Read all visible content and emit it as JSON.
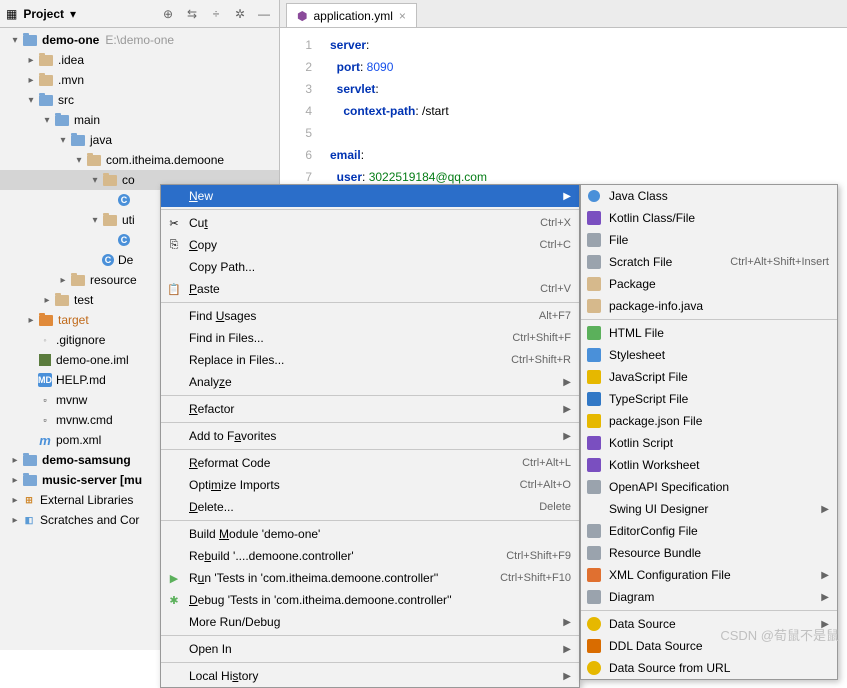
{
  "panel": {
    "title": "Project",
    "tools": [
      "target-icon",
      "arrow-down-icon",
      "divider-icon",
      "gear-icon",
      "collapse-icon"
    ]
  },
  "tree": [
    {
      "depth": 0,
      "arrow": "▾",
      "icon": "folder-blue",
      "label": "demo-one",
      "bold": true,
      "hint": "E:\\demo-one"
    },
    {
      "depth": 1,
      "arrow": "▸",
      "icon": "folder",
      "label": ".idea"
    },
    {
      "depth": 1,
      "arrow": "▸",
      "icon": "folder",
      "label": ".mvn"
    },
    {
      "depth": 1,
      "arrow": "▾",
      "icon": "folder-blue",
      "label": "src"
    },
    {
      "depth": 2,
      "arrow": "▾",
      "icon": "folder-blue",
      "label": "main"
    },
    {
      "depth": 3,
      "arrow": "▾",
      "icon": "folder-blue",
      "label": "java"
    },
    {
      "depth": 4,
      "arrow": "▾",
      "icon": "folder",
      "label": "com.itheima.demoone"
    },
    {
      "depth": 5,
      "arrow": "▾",
      "icon": "folder",
      "label": "co",
      "selected": true
    },
    {
      "depth": 6,
      "arrow": "",
      "icon": "class",
      "label": ""
    },
    {
      "depth": 5,
      "arrow": "▾",
      "icon": "folder",
      "label": "uti"
    },
    {
      "depth": 6,
      "arrow": "",
      "icon": "class",
      "label": ""
    },
    {
      "depth": 5,
      "arrow": "",
      "icon": "class",
      "label": "De"
    },
    {
      "depth": 3,
      "arrow": "▸",
      "icon": "folder",
      "label": "resource"
    },
    {
      "depth": 2,
      "arrow": "▸",
      "icon": "folder",
      "label": "test"
    },
    {
      "depth": 1,
      "arrow": "▸",
      "icon": "folder-orange",
      "label": "target",
      "orange": true
    },
    {
      "depth": 1,
      "arrow": "",
      "icon": "git",
      "label": ".gitignore"
    },
    {
      "depth": 1,
      "arrow": "",
      "icon": "iml",
      "label": "demo-one.iml"
    },
    {
      "depth": 1,
      "arrow": "",
      "icon": "md",
      "label": "HELP.md"
    },
    {
      "depth": 1,
      "arrow": "",
      "icon": "file",
      "label": "mvnw"
    },
    {
      "depth": 1,
      "arrow": "",
      "icon": "file",
      "label": "mvnw.cmd"
    },
    {
      "depth": 1,
      "arrow": "",
      "icon": "m",
      "label": "pom.xml"
    },
    {
      "depth": 0,
      "arrow": "▸",
      "icon": "folder-blue",
      "label": "demo-samsung",
      "bold": true
    },
    {
      "depth": 0,
      "arrow": "▸",
      "icon": "folder-blue",
      "label": "music-server [mu",
      "bold": true
    },
    {
      "depth": 0,
      "arrow": "▸",
      "icon": "libs",
      "label": "External Libraries"
    },
    {
      "depth": 0,
      "arrow": "▸",
      "icon": "scratch",
      "label": "Scratches and Cor"
    }
  ],
  "tab": {
    "label": "application.yml"
  },
  "code": {
    "lines": [
      {
        "n": 1,
        "tokens": [
          [
            "kw",
            "server"
          ],
          [
            "",
            ":"
          ]
        ]
      },
      {
        "n": 2,
        "tokens": [
          [
            "",
            "  "
          ],
          [
            "kw",
            "port"
          ],
          [
            "",
            ": "
          ],
          [
            "num",
            "8090"
          ]
        ]
      },
      {
        "n": 3,
        "tokens": [
          [
            "",
            "  "
          ],
          [
            "kw",
            "servlet"
          ],
          [
            "",
            ":"
          ]
        ]
      },
      {
        "n": 4,
        "tokens": [
          [
            "",
            "    "
          ],
          [
            "kw",
            "context-path"
          ],
          [
            "",
            ": /start"
          ]
        ]
      },
      {
        "n": 5,
        "tokens": []
      },
      {
        "n": 6,
        "tokens": [
          [
            "kw",
            "email"
          ],
          [
            "",
            ":"
          ]
        ]
      },
      {
        "n": 7,
        "tokens": [
          [
            "",
            "  "
          ],
          [
            "kw",
            "user"
          ],
          [
            "",
            ": "
          ],
          [
            "str",
            "3022519184@qq.com"
          ]
        ]
      }
    ]
  },
  "contextMenu": [
    {
      "icon": "",
      "label": "New",
      "shortcut": "",
      "arrow": true,
      "highlight": true,
      "u": 0
    },
    {
      "sep": true
    },
    {
      "icon": "✂",
      "label": "Cut",
      "shortcut": "Ctrl+X",
      "u": 2
    },
    {
      "icon": "⎘",
      "label": "Copy",
      "shortcut": "Ctrl+C",
      "u": 0
    },
    {
      "icon": "",
      "label": "Copy Path...",
      "shortcut": ""
    },
    {
      "icon": "📋",
      "label": "Paste",
      "shortcut": "Ctrl+V",
      "u": 0
    },
    {
      "sep": true
    },
    {
      "icon": "",
      "label": "Find Usages",
      "shortcut": "Alt+F7",
      "u": 5
    },
    {
      "icon": "",
      "label": "Find in Files...",
      "shortcut": "Ctrl+Shift+F"
    },
    {
      "icon": "",
      "label": "Replace in Files...",
      "shortcut": "Ctrl+Shift+R"
    },
    {
      "icon": "",
      "label": "Analyze",
      "shortcut": "",
      "arrow": true,
      "u": 5
    },
    {
      "sep": true
    },
    {
      "icon": "",
      "label": "Refactor",
      "shortcut": "",
      "arrow": true,
      "u": 0
    },
    {
      "sep": true
    },
    {
      "icon": "",
      "label": "Add to Favorites",
      "shortcut": "",
      "arrow": true,
      "u": 8
    },
    {
      "sep": true
    },
    {
      "icon": "",
      "label": "Reformat Code",
      "shortcut": "Ctrl+Alt+L",
      "u": 0
    },
    {
      "icon": "",
      "label": "Optimize Imports",
      "shortcut": "Ctrl+Alt+O",
      "u": 4
    },
    {
      "icon": "",
      "label": "Delete...",
      "shortcut": "Delete",
      "u": 0
    },
    {
      "sep": true
    },
    {
      "icon": "",
      "label": "Build Module 'demo-one'",
      "u": 6
    },
    {
      "icon": "",
      "label": "Rebuild '....demoone.controller'",
      "shortcut": "Ctrl+Shift+F9",
      "u": 2
    },
    {
      "icon": "▶",
      "iconColor": "#5bb05b",
      "label": "Run 'Tests in 'com.itheima.demoone.controller''",
      "shortcut": "Ctrl+Shift+F10",
      "u": 1
    },
    {
      "icon": "✱",
      "iconColor": "#5bb05b",
      "label": "Debug 'Tests in 'com.itheima.demoone.controller''",
      "u": 0
    },
    {
      "icon": "",
      "label": "More Run/Debug",
      "arrow": true
    },
    {
      "sep": true
    },
    {
      "icon": "",
      "label": "Open In",
      "arrow": true
    },
    {
      "sep": true
    },
    {
      "icon": "",
      "label": "Local History",
      "arrow": true,
      "u": 8
    }
  ],
  "newMenu": [
    {
      "badge": "b-c",
      "label": "Java Class"
    },
    {
      "badge": "b-k",
      "label": "Kotlin Class/File"
    },
    {
      "badge": "b-f",
      "label": "File"
    },
    {
      "badge": "b-f",
      "label": "Scratch File",
      "shortcut": "Ctrl+Alt+Shift+Insert"
    },
    {
      "badge": "b-pkg",
      "label": "Package"
    },
    {
      "badge": "b-pkg",
      "label": "package-info.java"
    },
    {
      "sep": true
    },
    {
      "badge": "b-h",
      "label": "HTML File"
    },
    {
      "badge": "b-css",
      "label": "Stylesheet"
    },
    {
      "badge": "b-js",
      "label": "JavaScript File"
    },
    {
      "badge": "b-ts",
      "label": "TypeScript File"
    },
    {
      "badge": "b-json",
      "label": "package.json File"
    },
    {
      "badge": "b-k",
      "label": "Kotlin Script"
    },
    {
      "badge": "b-k",
      "label": "Kotlin Worksheet"
    },
    {
      "badge": "b-f",
      "label": "OpenAPI Specification"
    },
    {
      "badge": "",
      "label": "Swing UI Designer",
      "arrow": true
    },
    {
      "badge": "b-f",
      "label": "EditorConfig File"
    },
    {
      "badge": "b-f",
      "label": "Resource Bundle"
    },
    {
      "badge": "b-xml",
      "label": "XML Configuration File",
      "arrow": true
    },
    {
      "badge": "b-f",
      "label": "Diagram",
      "arrow": true
    },
    {
      "sep": true
    },
    {
      "badge": "b-db",
      "label": "Data Source",
      "arrow": true
    },
    {
      "badge": "b-ddl",
      "label": "DDL Data Source"
    },
    {
      "badge": "b-db",
      "label": "Data Source from URL"
    }
  ],
  "watermark": "CSDN @荀鼠不是鼠"
}
